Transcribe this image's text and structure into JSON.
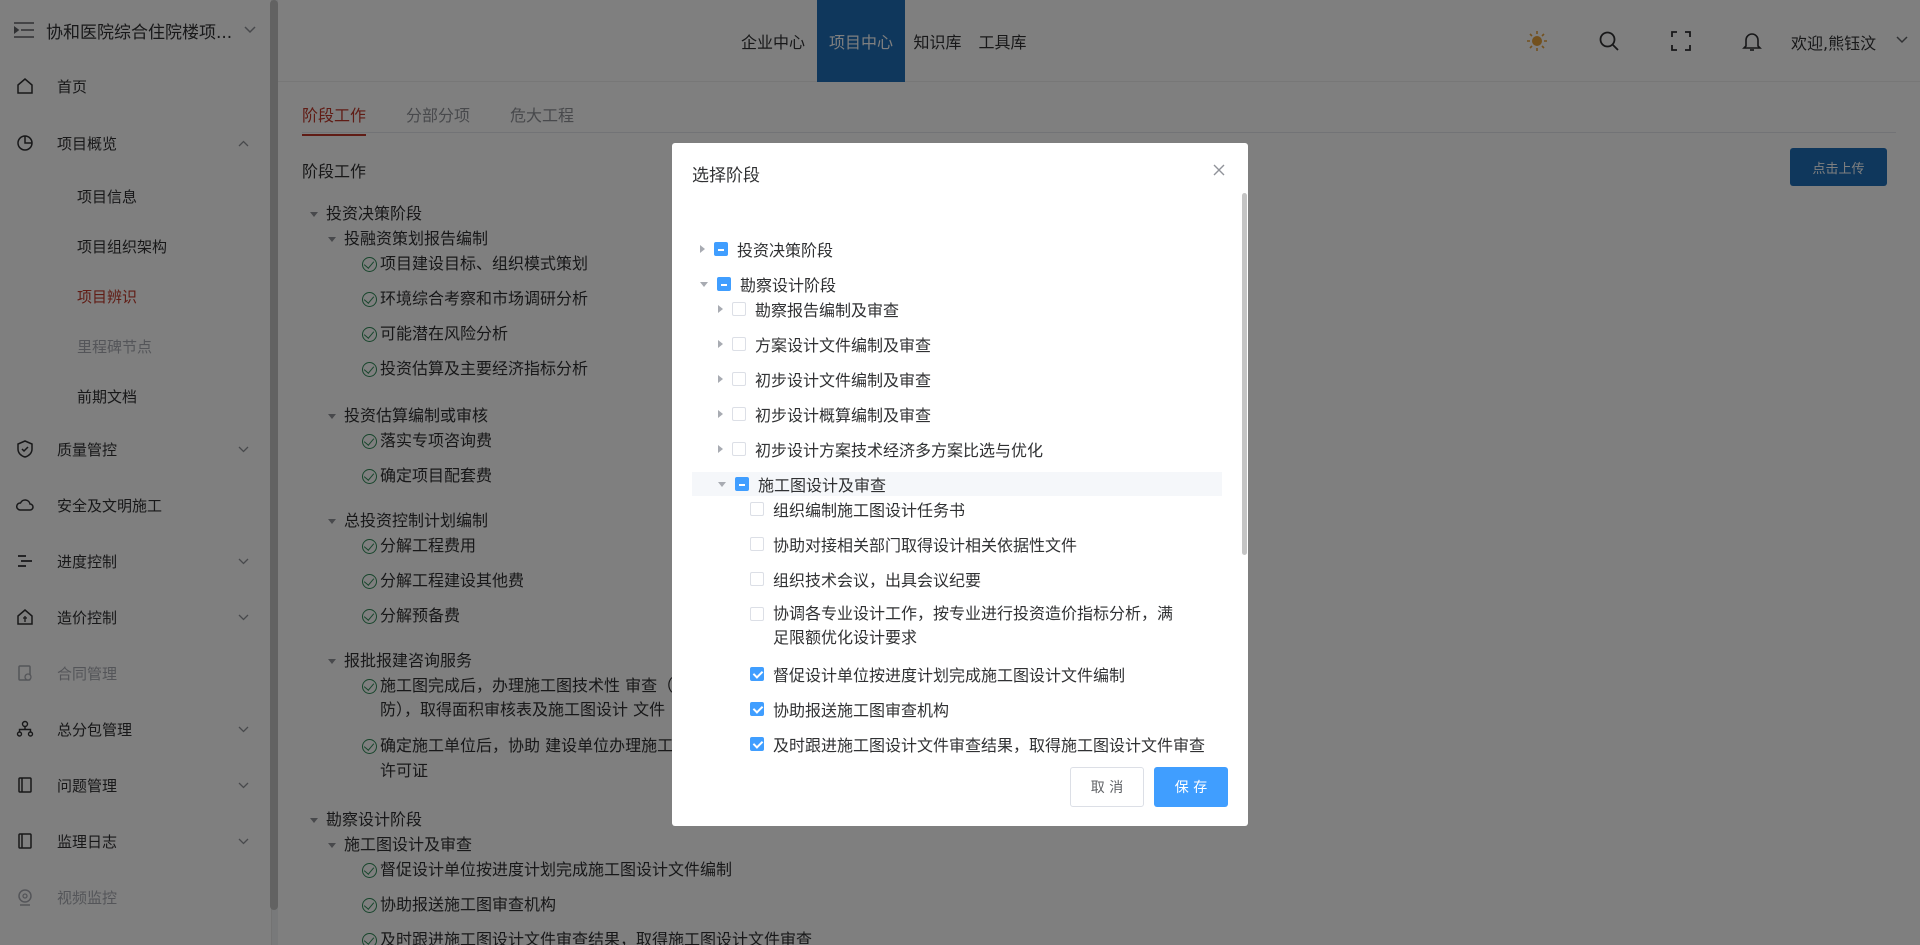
{
  "sidebar": {
    "title": "协和医院综合住院楼项...",
    "items": [
      {
        "label": "首页"
      },
      {
        "label": "项目概览"
      },
      {
        "label": "项目信息"
      },
      {
        "label": "项目组织架构"
      },
      {
        "label": "项目辨识"
      },
      {
        "label": "里程碑节点"
      },
      {
        "label": "前期文档"
      },
      {
        "label": "质量管控"
      },
      {
        "label": "安全及文明施工"
      },
      {
        "label": "进度控制"
      },
      {
        "label": "造价控制"
      },
      {
        "label": "合同管理"
      },
      {
        "label": "总分包管理"
      },
      {
        "label": "问题管理"
      },
      {
        "label": "监理日志"
      },
      {
        "label": "视频监控"
      }
    ]
  },
  "header": {
    "nav": [
      "企业中心",
      "项目中心",
      "知识库",
      "工具库"
    ],
    "active_nav": "项目中心",
    "welcome": "欢迎,熊钰汶"
  },
  "tabs": [
    "阶段工作",
    "分部分项",
    "危大工程"
  ],
  "section_title": "阶段工作",
  "upload_label": "点击上传",
  "background_tree": {
    "n0": "投资决策阶段",
    "n1": "投融资策划报告编制",
    "n2": "项目建设目标、组织模式策划",
    "n3": "环境综合考察和市场调研分析",
    "n4": "可能潜在风险分析",
    "n5": "投资估算及主要经济指标分析",
    "n6": "投资估算编制或审核",
    "n7": "落实专项咨询费",
    "n8": "确定项目配套费",
    "n9": "总投资控制计划编制",
    "n10": "分解工程费用",
    "n11": "分解工程建设其他费",
    "n12": "分解预备费",
    "n13": "报批报建咨询服务",
    "n14a": "施工图完成后，办理施工图技术性  审查（",
    "n14b": "防），取得面积审核表及施工图设计  文件",
    "n15a": "确定施工单位后，协助  建设单位办理施工",
    "n15b": "许可证",
    "n16": "勘察设计阶段",
    "n17": "施工图设计及审查",
    "n18": "督促设计单位按进度计划完成施工图设计文件编制",
    "n19": "协助报送施工图审查机构",
    "n20": "及时跟进施工图设计文件审查结果，取得施工图设计文件审查"
  },
  "dialog": {
    "title": "选择阶段",
    "nodes": {
      "d0": "投资决策阶段",
      "d1": "勘察设计阶段",
      "d2": "勘察报告编制及审查",
      "d3": "方案设计文件编制及审查",
      "d4": "初步设计文件编制及审查",
      "d5": "初步设计概算编制及审查",
      "d6": "初步设计方案技术经济多方案比选与优化",
      "d7": "施工图设计及审查",
      "d8": "组织编制施工图设计任务书",
      "d9": "协助对接相关部门取得设计相关依据性文件",
      "d10": "组织技术会议，出具会议纪要",
      "d11": "协调各专业设计工作，按专业进行投资造价指标分析，满足限额优化设计要求",
      "d12": "督促设计单位按进度计划完成施工图设计文件编制",
      "d13": "协助报送施工图审查机构",
      "d14": "及时跟进施工图设计文件审查结果，取得施工图设计文件审查"
    },
    "cancel_label": "取 消",
    "save_label": "保 存"
  },
  "colors": {
    "accent": "#1f6fb8",
    "primary_button": "#409eff",
    "active_tab": "#c0392b"
  }
}
